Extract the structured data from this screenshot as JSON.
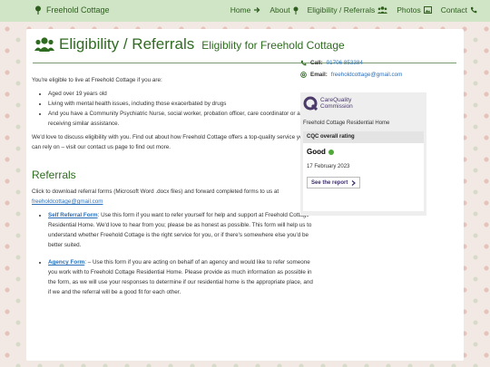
{
  "nav": {
    "brand": "Freehold Cottage",
    "links": [
      {
        "label": "Home",
        "icon": "arrow-right-icon"
      },
      {
        "label": "About",
        "icon": "pin-icon"
      },
      {
        "label": "Eligibility / Referrals",
        "icon": "users-icon"
      },
      {
        "label": "Photos",
        "icon": "image-icon"
      },
      {
        "label": "Contact",
        "icon": "phone-icon"
      }
    ],
    "colors": {
      "bar": "#cfe5c6",
      "text": "#2f5e1f"
    }
  },
  "page": {
    "title": "Eligibility / Referrals",
    "subtitle": "Eligiblity for Freehold Cottage"
  },
  "eligibility": {
    "intro": "You're eligible to live at Freehold Cottage if you are:",
    "criteria": [
      "Aged over 19 years old",
      "Living with mental health issues, including those exacerbated by drugs",
      "And you have a Community Psychiatric Nurse, social worker, probation officer, care coordinator or are receiving similar assistance."
    ],
    "outro": "We'd love to discuss eligibility with you. Find out about how Freehold Cottage offers a top-quality service you can rely on – visit our contact us page to find out more."
  },
  "referrals": {
    "heading": "Referrals",
    "intro": "Click to download referral forms (Microsoft Word .docx files) and forward completed forms to us at",
    "email": "freeholdcottage@gmail.com",
    "forms": [
      {
        "link": "Self Referral Form",
        "text": ": Use this form if you want to refer yourself for help and support at Freehold Cottage Residential Home. We'd love to hear from you; please be as honest as possible. This form will help us to understand whether Freehold Cottage is the right service for you, or if there's somewhere else you'd be better suited."
      },
      {
        "link": "Agency Form",
        "text": ": – Use this form if you are acting on behalf of an agency and would like to refer someone you work with to Freehold Cottage Residential Home. Please provide as much information as possible in the form, as we will use your responses to determine if our residential home is the appropriate place, and if we and the referral will be a good fit for each other."
      }
    ]
  },
  "contact": {
    "call_label": "Call:",
    "call_value": "01706 853384",
    "email_label": "Email:",
    "email_value": "freeholdcottage@gmail.com"
  },
  "cqc": {
    "logo_line1": "CareQuality",
    "logo_line2": "Commission",
    "home_name": "Freehold Cottage Residential Home",
    "rating_header": "CQC overall rating",
    "rating": "Good",
    "date": "17 February 2023",
    "report_button": "See the report",
    "good_color": "#4fa838"
  }
}
